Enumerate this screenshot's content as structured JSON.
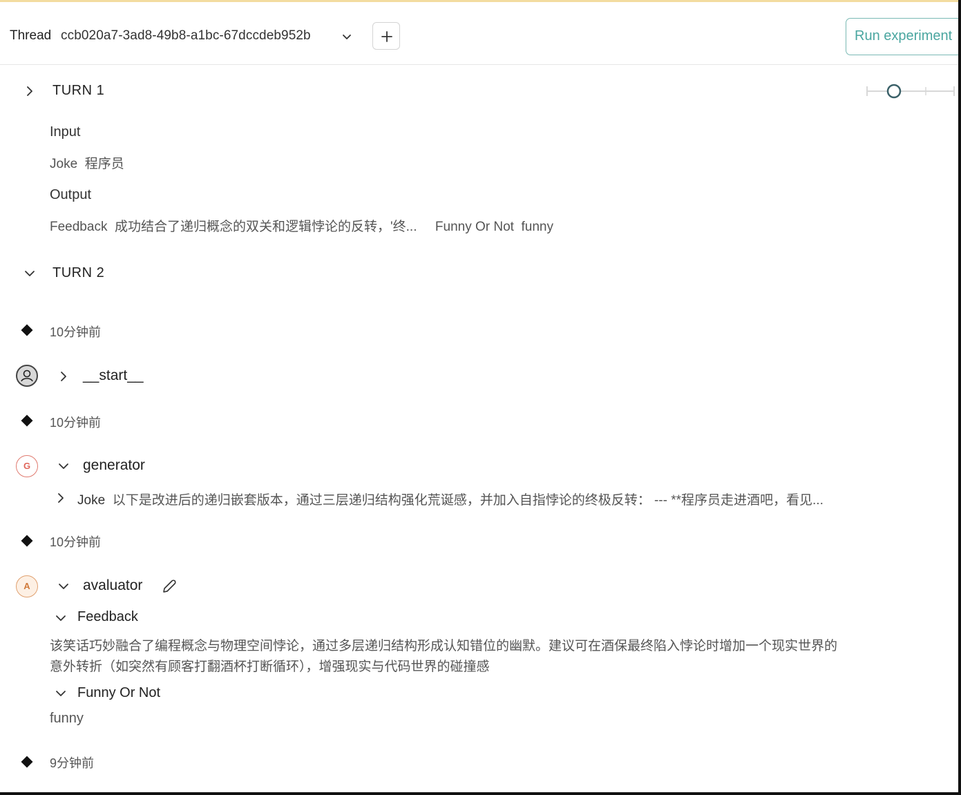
{
  "header": {
    "thread_label": "Thread",
    "thread_id": "ccb020a7-3ad8-49b8-a1bc-67dccdeb952b",
    "run_button": "Run experiment"
  },
  "turn1": {
    "title": "TURN 1",
    "input_label": "Input",
    "input_key": "Joke",
    "input_value": "程序员",
    "output_label": "Output",
    "feedback_key": "Feedback",
    "feedback_value": "成功结合了递归概念的双关和逻辑悖论的反转，'终...",
    "funny_key": "Funny Or Not",
    "funny_value": "funny"
  },
  "turn2": {
    "title": "TURN 2",
    "events": {
      "t1": "10分钟前",
      "t2": "10分钟前",
      "t3": "10分钟前",
      "t4": "9分钟前"
    },
    "start_node": "__start__",
    "generator": {
      "avatar": "G",
      "name": "generator",
      "joke_key": "Joke",
      "joke_value": "以下是改进后的递归嵌套版本，通过三层递归结构强化荒诞感，并加入自指悖论的终极反转： --- **程序员走进酒吧，看见..."
    },
    "evaluator": {
      "avatar": "A",
      "name": "avaluator",
      "feedback_label": "Feedback",
      "feedback_line1": "该笑话巧妙融合了编程概念与物理空间悖论，通过多层递归结构形成认知错位的幽默。建议可在酒保最终陷入悖论时增加一个现实世界的",
      "feedback_line2": "意外转折（如突然有顾客打翻酒杯打断循环），增强现实与代码世界的碰撞感",
      "funny_label": "Funny Or Not",
      "funny_value": "funny"
    }
  },
  "icons": {
    "collapsed": "chevron-right-icon",
    "expanded": "chevron-down-icon",
    "add": "plus-icon",
    "edit": "pencil-icon",
    "user": "user-avatar-icon"
  },
  "colors": {
    "accent_teal": "#4aa6a0",
    "generator_badge": "#e0655a",
    "evaluator_badge": "#d07a3a",
    "top_accent": "#f3dca0"
  }
}
